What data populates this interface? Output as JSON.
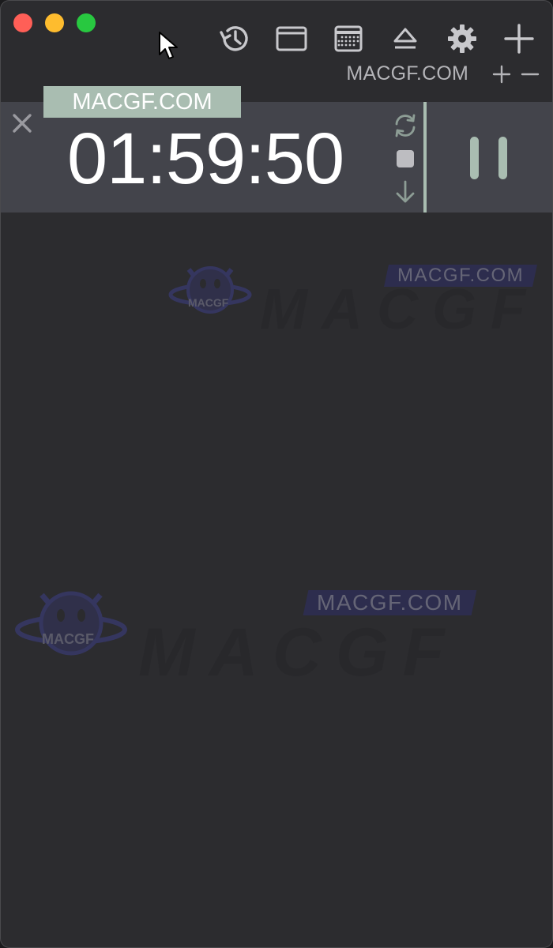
{
  "window": {
    "traffic_lights": {
      "close": "#ff5f57",
      "minimize": "#febc2e",
      "zoom": "#28c840"
    }
  },
  "toolbar": {
    "icons": [
      "history-icon",
      "window-icon",
      "calendar-icon",
      "eject-icon",
      "gear-icon",
      "plus-icon"
    ]
  },
  "subbar": {
    "label": "MACGF.COM",
    "add_icon": "plus-icon",
    "remove_icon": "minus-icon"
  },
  "timer": {
    "label": "MACGF.COM",
    "time": "01:59:50",
    "label_bg": "#a9bdb1",
    "row_bg": "#43444b",
    "controls": [
      "repeat-icon",
      "stop-icon",
      "arrow-down-icon"
    ],
    "pause_icon": "pause-icon"
  },
  "watermarks": [
    {
      "tag": "MACGF.COM",
      "badge": "MACGF",
      "word": "MACGF"
    },
    {
      "tag": "MACGF.COM",
      "badge": "MACGF",
      "word": "MACGF"
    }
  ],
  "colors": {
    "background": "#2c2c2f",
    "accent": "#a9bdb1",
    "text": "#ffffff"
  }
}
